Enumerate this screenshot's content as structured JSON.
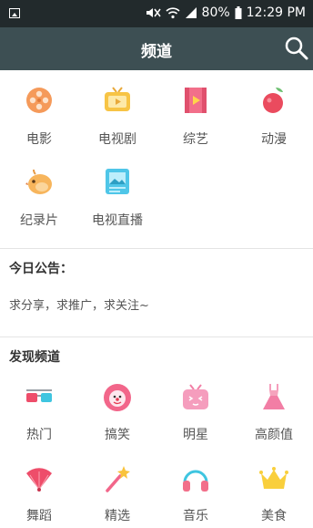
{
  "status_bar": {
    "battery": "80%",
    "time": "12:29 PM"
  },
  "app_bar": {
    "title": "频道"
  },
  "categories": [
    {
      "label": "电影",
      "icon": "film-reel-icon"
    },
    {
      "label": "电视剧",
      "icon": "tv-icon"
    },
    {
      "label": "综艺",
      "icon": "video-play-icon"
    },
    {
      "label": "动漫",
      "icon": "cartoon-fruit-icon"
    },
    {
      "label": "纪录片",
      "icon": "bird-icon"
    },
    {
      "label": "电视直播",
      "icon": "live-tv-icon"
    }
  ],
  "notice": {
    "title": "今日公告：",
    "text": "求分享，求推广，求关注~"
  },
  "discover": {
    "title": "发现频道",
    "items": [
      {
        "label": "热门",
        "icon": "3d-glasses-icon"
      },
      {
        "label": "搞笑",
        "icon": "clown-icon"
      },
      {
        "label": "明星",
        "icon": "tv-face-icon"
      },
      {
        "label": "高颜值",
        "icon": "dress-icon"
      },
      {
        "label": "舞蹈",
        "icon": "fan-icon"
      },
      {
        "label": "精选",
        "icon": "magic-wand-icon"
      },
      {
        "label": "音乐",
        "icon": "headphones-icon"
      },
      {
        "label": "美食",
        "icon": "crown-icon"
      }
    ]
  },
  "colors": {
    "app_bar": "#3d4f53",
    "status_bar": "#222a2c"
  }
}
